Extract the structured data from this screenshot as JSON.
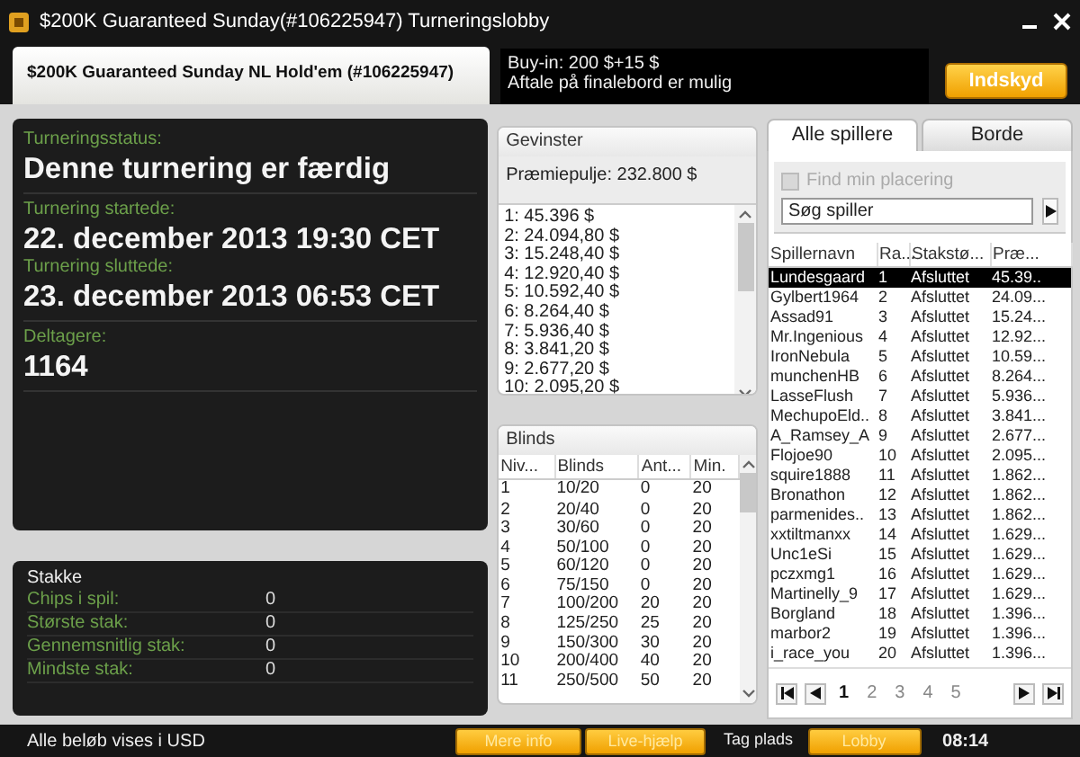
{
  "window": {
    "title": "$200K Guaranteed Sunday(#106225947) Turneringslobby"
  },
  "header": {
    "tournament_name": "$200K Guaranteed Sunday NL Hold'em (#106225947)",
    "info_lines": [
      "Buy-in: 200 $+15 $",
      "Aftale på finalebord er mulig"
    ],
    "register_button": "Indskyd"
  },
  "details": [
    {
      "label": "Turneringsstatus:",
      "value": "Denne turnering er færdig"
    },
    {
      "label": "Turnering startede:",
      "value": "22. december 2013  19:30 CET"
    },
    {
      "label": "Turnering sluttede:",
      "value": "23. december 2013  06:53 CET"
    },
    {
      "label": "Deltagere:",
      "value": "1164"
    }
  ],
  "stacks": {
    "title": "Stakke",
    "rows": [
      {
        "label": "Chips i spil:",
        "value": "0"
      },
      {
        "label": "Største stak:",
        "value": "0"
      },
      {
        "label": "Gennemsnitlig stak:",
        "value": "0"
      },
      {
        "label": "Mindste stak:",
        "value": "0"
      }
    ]
  },
  "prizes": {
    "title": "Gevinster",
    "pool": "Præmiepulje: 232.800 $",
    "places": [
      "1: 45.396 $",
      "2: 24.094,80 $",
      "3: 15.248,40 $",
      "4: 12.920,40 $",
      "5: 10.592,40 $",
      "6: 8.264,40 $",
      "7: 5.936,40 $",
      "8: 3.841,20 $",
      "9: 2.677,20 $",
      "10: 2.095,20 $"
    ]
  },
  "blinds": {
    "title": "Blinds",
    "columns": [
      "Niv...",
      "Blinds",
      "Ant...",
      "Min."
    ],
    "rows": [
      [
        "1",
        "10/20",
        "0",
        "20"
      ],
      [
        "2",
        "20/40",
        "0",
        "20"
      ],
      [
        "3",
        "30/60",
        "0",
        "20"
      ],
      [
        "4",
        "50/100",
        "0",
        "20"
      ],
      [
        "5",
        "60/120",
        "0",
        "20"
      ],
      [
        "6",
        "75/150",
        "0",
        "20"
      ],
      [
        "7",
        "100/200",
        "20",
        "20"
      ],
      [
        "8",
        "125/250",
        "25",
        "20"
      ],
      [
        "9",
        "150/300",
        "30",
        "20"
      ],
      [
        "10",
        "200/400",
        "40",
        "20"
      ],
      [
        "11",
        "250/500",
        "50",
        "20"
      ]
    ]
  },
  "players": {
    "tabs": [
      {
        "label": "Alle spillere",
        "selected": true
      },
      {
        "label": "Borde",
        "selected": false
      }
    ],
    "find_me": {
      "label": "Find min placering",
      "checked": false,
      "disabled": true
    },
    "search": {
      "placeholder": "Søg spiller"
    },
    "columns": [
      "Spillernavn",
      "Ra...",
      "Stakstø...",
      "Præ..."
    ],
    "rows": [
      {
        "cells": [
          "Lundesgaard",
          "1",
          "Afsluttet",
          "45.39.."
        ],
        "selected": true
      },
      {
        "cells": [
          "Gylbert1964",
          "2",
          "Afsluttet",
          "24.09..."
        ],
        "selected": false
      },
      {
        "cells": [
          "Assad91",
          "3",
          "Afsluttet",
          "15.24..."
        ],
        "selected": false
      },
      {
        "cells": [
          "Mr.Ingenious",
          "4",
          "Afsluttet",
          "12.92..."
        ],
        "selected": false
      },
      {
        "cells": [
          "IronNebula",
          "5",
          "Afsluttet",
          "10.59..."
        ],
        "selected": false
      },
      {
        "cells": [
          "munchenHB",
          "6",
          "Afsluttet",
          "8.264..."
        ],
        "selected": false
      },
      {
        "cells": [
          "LasseFlush",
          "7",
          "Afsluttet",
          "5.936..."
        ],
        "selected": false
      },
      {
        "cells": [
          "MechupoEld..",
          "8",
          "Afsluttet",
          "3.841..."
        ],
        "selected": false
      },
      {
        "cells": [
          "A_Ramsey_A",
          "9",
          "Afsluttet",
          "2.677..."
        ],
        "selected": false
      },
      {
        "cells": [
          "Flojoe90",
          "10",
          "Afsluttet",
          "2.095..."
        ],
        "selected": false
      },
      {
        "cells": [
          "squire1888",
          "11",
          "Afsluttet",
          "1.862..."
        ],
        "selected": false
      },
      {
        "cells": [
          "Bronathon",
          "12",
          "Afsluttet",
          "1.862..."
        ],
        "selected": false
      },
      {
        "cells": [
          "parmenides..",
          "13",
          "Afsluttet",
          "1.862..."
        ],
        "selected": false
      },
      {
        "cells": [
          "xxtiltmanxx",
          "14",
          "Afsluttet",
          "1.629..."
        ],
        "selected": false
      },
      {
        "cells": [
          "Unc1eSi",
          "15",
          "Afsluttet",
          "1.629..."
        ],
        "selected": false
      },
      {
        "cells": [
          "pczxmg1",
          "16",
          "Afsluttet",
          "1.629..."
        ],
        "selected": false
      },
      {
        "cells": [
          "Martinelly_9",
          "17",
          "Afsluttet",
          "1.629..."
        ],
        "selected": false
      },
      {
        "cells": [
          "Borgland",
          "18",
          "Afsluttet",
          "1.396..."
        ],
        "selected": false
      },
      {
        "cells": [
          "marbor2",
          "19",
          "Afsluttet",
          "1.396..."
        ],
        "selected": false
      },
      {
        "cells": [
          "i_race_you",
          "20",
          "Afsluttet",
          "1.396..."
        ],
        "selected": false
      }
    ],
    "pages": [
      {
        "label": "1",
        "selected": true
      },
      {
        "label": "2",
        "selected": false
      },
      {
        "label": "3",
        "selected": false
      },
      {
        "label": "4",
        "selected": false
      },
      {
        "label": "5",
        "selected": false
      }
    ]
  },
  "status_bar": {
    "text": "Alle beløb vises i USD",
    "buttons": [
      {
        "label": "Mere info",
        "kind": "button"
      },
      {
        "label": "Live-hjælp",
        "kind": "button"
      },
      {
        "label": "Tag plads",
        "kind": "plain"
      },
      {
        "label": "Lobby",
        "kind": "button"
      }
    ],
    "clock": "08:14"
  }
}
